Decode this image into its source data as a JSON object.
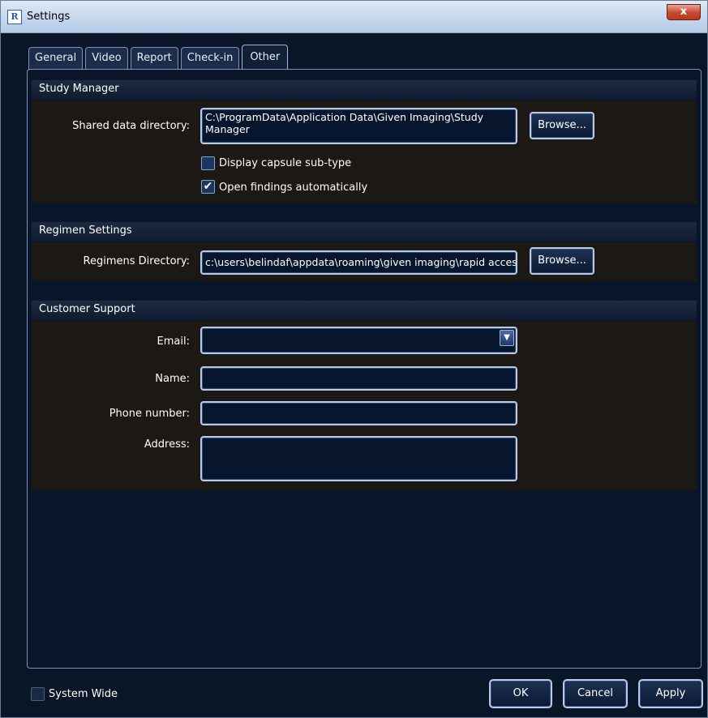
{
  "window": {
    "title": "Settings",
    "close_label": "x",
    "app_icon_letter": "R"
  },
  "tabs": [
    {
      "label": "General",
      "active": false
    },
    {
      "label": "Video",
      "active": false
    },
    {
      "label": "Report",
      "active": false
    },
    {
      "label": "Check-in",
      "active": false
    },
    {
      "label": "Other",
      "active": true
    }
  ],
  "study_manager": {
    "header": "Study Manager",
    "shared_dir_label": "Shared data directory:",
    "shared_dir_value": "C:\\ProgramData\\Application Data\\Given Imaging\\Study Manager",
    "browse_label": "Browse...",
    "display_subtype_label": "Display capsule sub-type",
    "display_subtype_checked": false,
    "open_findings_label": "Open findings automatically",
    "open_findings_checked": true
  },
  "regimen": {
    "header": "Regimen Settings",
    "dir_label": "Regimens Directory:",
    "dir_value": "c:\\users\\belindaf\\appdata\\roaming\\given imaging\\rapid acces",
    "browse_label": "Browse..."
  },
  "support": {
    "header": "Customer Support",
    "email_label": "Email:",
    "email_value": "",
    "name_label": "Name:",
    "name_value": "",
    "phone_label": "Phone number:",
    "phone_value": "",
    "address_label": "Address:",
    "address_value": ""
  },
  "footer": {
    "system_wide_label": "System Wide",
    "system_wide_checked": false,
    "ok_label": "OK",
    "cancel_label": "Cancel",
    "apply_label": "Apply"
  },
  "colors": {
    "background": "#091627",
    "section_body": "#1c1813",
    "field_border": "#b9c9e6",
    "titlebar": "#c3d5ec"
  }
}
